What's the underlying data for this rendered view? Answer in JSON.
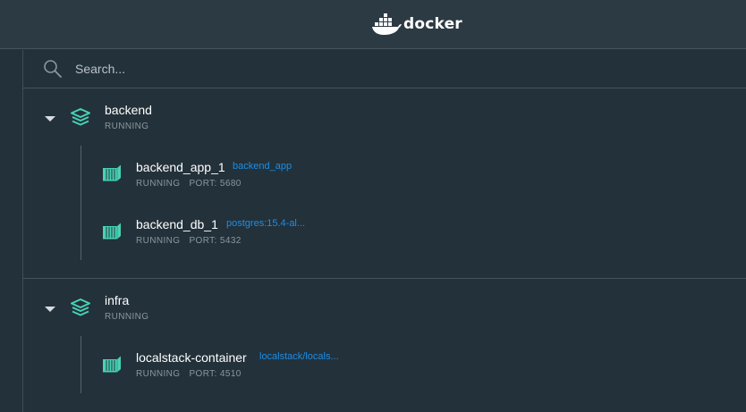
{
  "header": {
    "brand": "docker"
  },
  "search": {
    "placeholder": "Search..."
  },
  "groups": [
    {
      "name": "backend",
      "status": "RUNNING",
      "containers": [
        {
          "name": "backend_app_1",
          "image": "backend_app",
          "status": "RUNNING",
          "port": "PORT: 5680"
        },
        {
          "name": "backend_db_1",
          "image": "postgres:15.4-al...",
          "status": "RUNNING",
          "port": "PORT: 5432"
        }
      ]
    },
    {
      "name": "infra",
      "status": "RUNNING",
      "containers": [
        {
          "name": "localstack-container",
          "image": "localstack/locals...",
          "status": "RUNNING",
          "port": "PORT: 4510"
        }
      ]
    }
  ],
  "colors": {
    "background": "#23313a",
    "header": "#2c3a43",
    "accent_teal": "#48d2b5",
    "link_blue": "#1d8ee6",
    "muted": "#8a979f"
  },
  "icons": [
    "docker-logo-icon",
    "search-icon",
    "caret-down-icon",
    "stack-icon",
    "container-icon"
  ]
}
